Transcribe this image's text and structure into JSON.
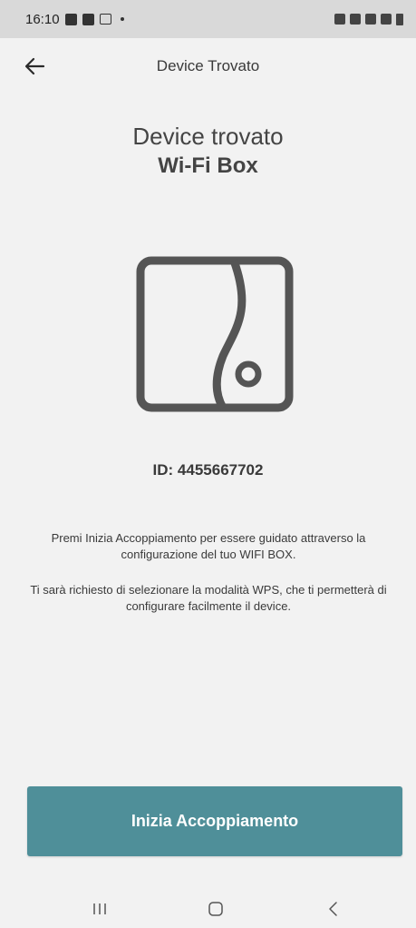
{
  "status_bar": {
    "time": "16:10",
    "left_icons": [
      "image-icon",
      "hi-app-icon",
      "gmail-icon",
      "dot-icon"
    ],
    "right_icons": [
      "alarm-icon",
      "mute-icon",
      "wifi-icon",
      "signal-icon",
      "battery-icon"
    ]
  },
  "app_bar": {
    "title": "Device Trovato",
    "back_icon": "arrow-left-icon"
  },
  "heading": {
    "line1": "Device trovato",
    "line2": "Wi-Fi Box"
  },
  "device": {
    "icon": "wifi-box-device-icon",
    "id_text": "ID: 4455667702"
  },
  "description": {
    "paragraph1": "Premi Inizia Accoppiamento per essere guidato attraverso la configurazione del tuo WIFI BOX.",
    "paragraph2": "Ti sarà richiesto di selezionare la modalità WPS, che ti permetterà di configurare facilmente il device."
  },
  "primary_button": {
    "label": "Inizia Accoppiamento",
    "color": "#4f8f99"
  },
  "nav_bar": {
    "icons": [
      "recent-apps-icon",
      "home-icon",
      "back-nav-icon"
    ]
  }
}
